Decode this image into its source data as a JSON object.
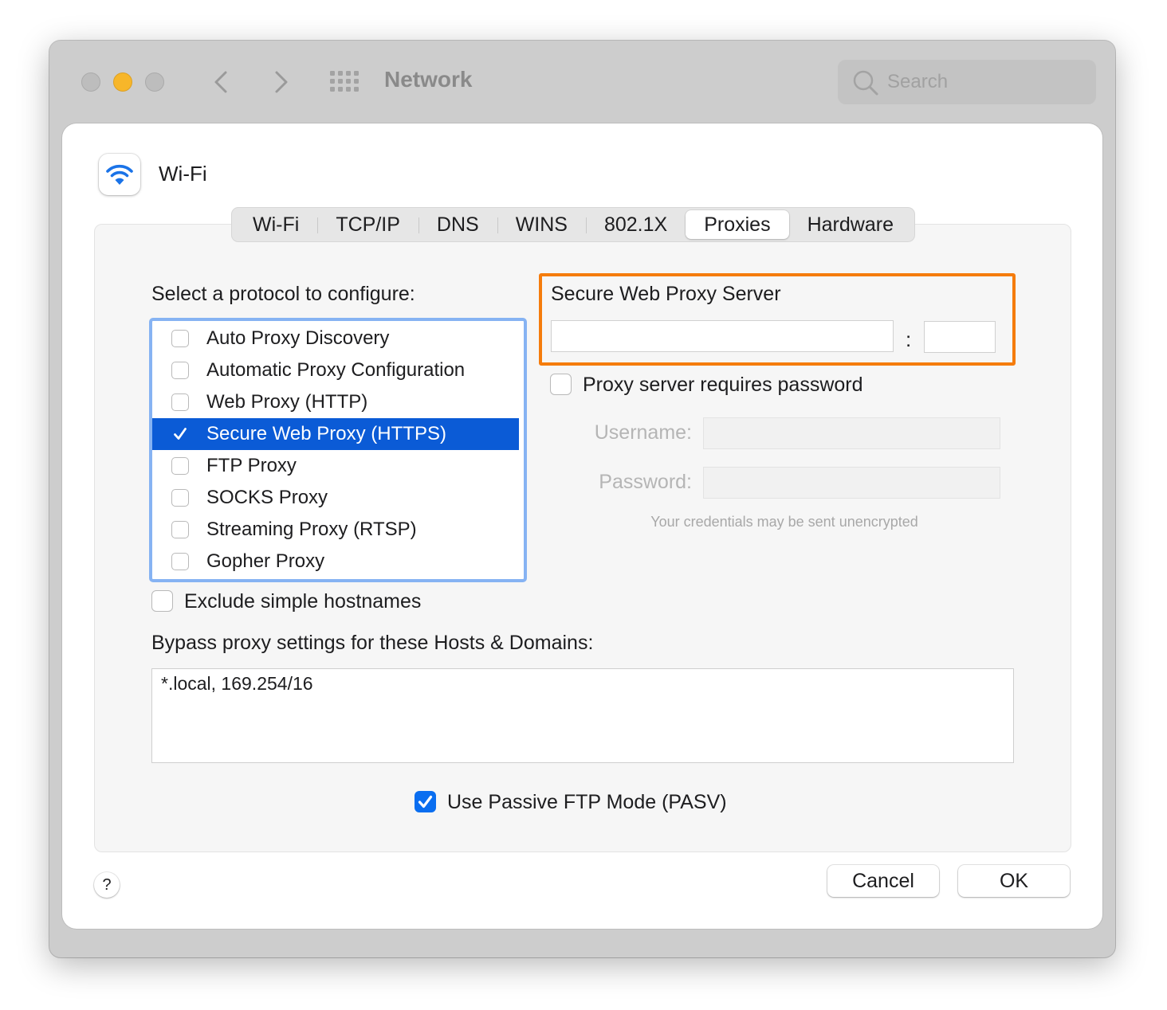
{
  "window": {
    "title": "Network"
  },
  "search": {
    "placeholder": "Search"
  },
  "interface": {
    "name": "Wi-Fi",
    "icon": "wifi-icon"
  },
  "tabs": [
    {
      "label": "Wi-Fi",
      "active": false
    },
    {
      "label": "TCP/IP",
      "active": false
    },
    {
      "label": "DNS",
      "active": false
    },
    {
      "label": "WINS",
      "active": false
    },
    {
      "label": "802.1X",
      "active": false
    },
    {
      "label": "Proxies",
      "active": true
    },
    {
      "label": "Hardware",
      "active": false
    }
  ],
  "protocols": {
    "label": "Select a protocol to configure:",
    "items": [
      {
        "label": "Auto Proxy Discovery",
        "checked": false,
        "selected": false
      },
      {
        "label": "Automatic Proxy Configuration",
        "checked": false,
        "selected": false
      },
      {
        "label": "Web Proxy (HTTP)",
        "checked": false,
        "selected": false
      },
      {
        "label": "Secure Web Proxy (HTTPS)",
        "checked": true,
        "selected": true
      },
      {
        "label": "FTP Proxy",
        "checked": false,
        "selected": false
      },
      {
        "label": "SOCKS Proxy",
        "checked": false,
        "selected": false
      },
      {
        "label": "Streaming Proxy (RTSP)",
        "checked": false,
        "selected": false
      },
      {
        "label": "Gopher Proxy",
        "checked": false,
        "selected": false
      }
    ]
  },
  "server": {
    "label": "Secure Web Proxy Server",
    "host_value": "",
    "port_value": "",
    "colon": ":",
    "highlight_color": "#f57c0c"
  },
  "auth": {
    "requires_password_label": "Proxy server requires password",
    "requires_password_checked": false,
    "username_label": "Username:",
    "password_label": "Password:",
    "hint": "Your credentials may be sent unencrypted"
  },
  "exclude_simple": {
    "label": "Exclude simple hostnames",
    "checked": false
  },
  "bypass": {
    "label": "Bypass proxy settings for these Hosts & Domains:",
    "value": "*.local, 169.254/16"
  },
  "pasv": {
    "label": "Use Passive FTP Mode (PASV)",
    "checked": true
  },
  "buttons": {
    "help": "?",
    "cancel": "Cancel",
    "ok": "OK"
  },
  "colors": {
    "accent": "#0a6ef0",
    "selection": "#0b5bd6",
    "list_focus": "#86b3f3"
  }
}
